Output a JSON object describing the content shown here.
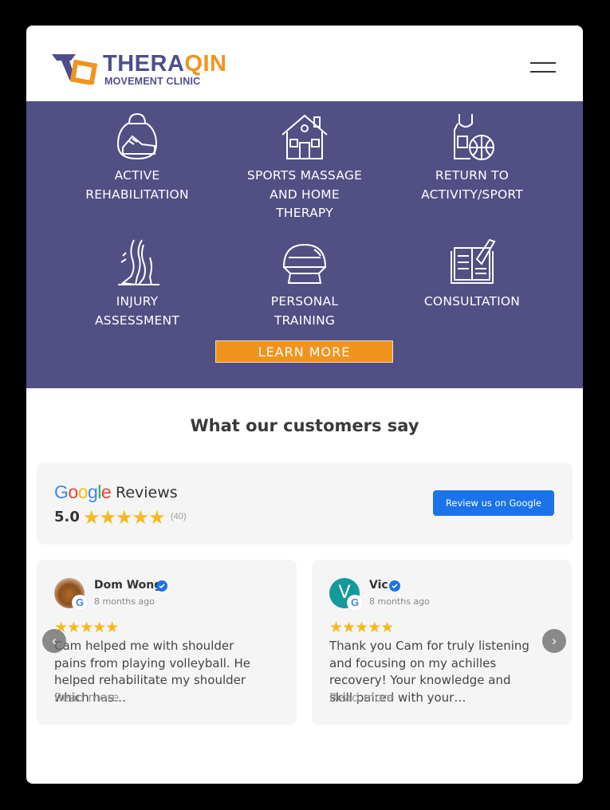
{
  "brand": {
    "name_part1": "THERA",
    "name_part2": "QIN",
    "subtitle": "MOVEMENT CLINIC"
  },
  "menu": {
    "icon": "hamburger-menu-icon"
  },
  "services": [
    {
      "line1": "ACTIVE",
      "line2": "REHABILITATION",
      "line3": "",
      "icon": "kettlebell-shoe-icon"
    },
    {
      "line1": "SPORTS MASSAGE",
      "line2": "AND HOME",
      "line3": "THERAPY",
      "icon": "house-icon"
    },
    {
      "line1": "RETURN TO",
      "line2": "ACTIVITY/SPORT",
      "line3": "",
      "icon": "jersey-basketball-icon"
    },
    {
      "line1": "INJURY",
      "line2": "ASSESSMENT",
      "line3": "",
      "icon": "legs-icon"
    },
    {
      "line1": "PERSONAL",
      "line2": "TRAINING",
      "line3": "",
      "icon": "bosu-ball-icon"
    },
    {
      "line1": "CONSULTATION",
      "line2": "",
      "line3": "",
      "icon": "notebook-pen-icon"
    }
  ],
  "learn_more_label": "LEARN MORE",
  "reviews_section": {
    "title": "What our customers say",
    "google_word": "Google",
    "reviews_word": "Reviews",
    "rating": "5.0",
    "stars": "★★★★★",
    "count": "(40)",
    "cta": "Review us on Google"
  },
  "reviews": [
    {
      "name": "Dom Wong",
      "time": "8 months ago",
      "stars": "★★★★★",
      "text": "Cam helped me with shoulder pains from playing volleyball. He helped rehabilitate my shoulder which has…",
      "more": "Read more",
      "avatar_letter": ""
    },
    {
      "name": "Vic",
      "time": "8 months ago",
      "stars": "★★★★★",
      "text": "Thank you Cam for truly listening and focusing on my achilles recovery! Your knowledge and skill paired with your…",
      "more": "Read more",
      "avatar_letter": "V"
    }
  ],
  "carousel": {
    "prev": "‹",
    "next": "›"
  },
  "colors": {
    "purple": "#524f84",
    "orange": "#f0941e",
    "google_blue": "#1a73e8",
    "star": "#f8b81c"
  }
}
